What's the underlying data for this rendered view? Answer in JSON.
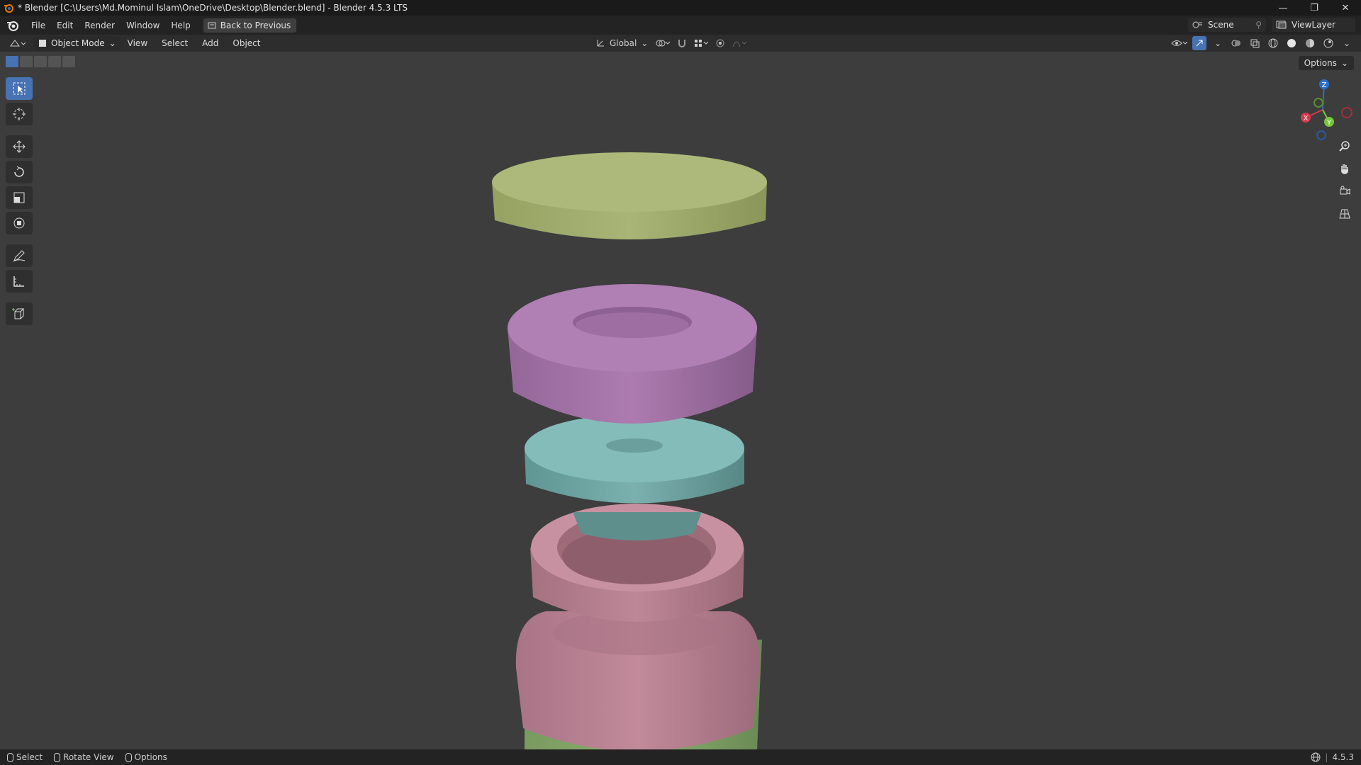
{
  "window": {
    "title": "* Blender [C:\\Users\\Md.Mominul Islam\\OneDrive\\Desktop\\Blender.blend] - Blender 4.5.3 LTS",
    "minimize": "—",
    "maximize": "❐",
    "close": "✕"
  },
  "menu": {
    "items": [
      "File",
      "Edit",
      "Render",
      "Window",
      "Help"
    ],
    "back_button": "Back to Previous",
    "scene": "Scene",
    "view_layer": "ViewLayer"
  },
  "viewport_header": {
    "mode": "Object Mode",
    "menus": [
      "View",
      "Select",
      "Add",
      "Object"
    ],
    "transform_orientation": "Global"
  },
  "viewport": {
    "options_label": "Options"
  },
  "toolbar": {
    "tools": [
      "select-box",
      "cursor",
      "move",
      "rotate",
      "scale",
      "transform",
      "annotate",
      "measure",
      "add-cube"
    ],
    "active": "select-box"
  },
  "objects": {
    "colors": {
      "lid": "#a4b070",
      "ring_top": "#a776a9",
      "teal_disk": "#76aaa8",
      "pink_ring": "#b78395",
      "pink_body": "#bc8596",
      "green_body": "#86ad6c"
    }
  },
  "gizmo": {
    "axes": [
      "Z",
      "X",
      "Y"
    ]
  },
  "status": {
    "select": "Select",
    "rotate": "Rotate View",
    "options": "Options",
    "version": "4.5.3"
  }
}
